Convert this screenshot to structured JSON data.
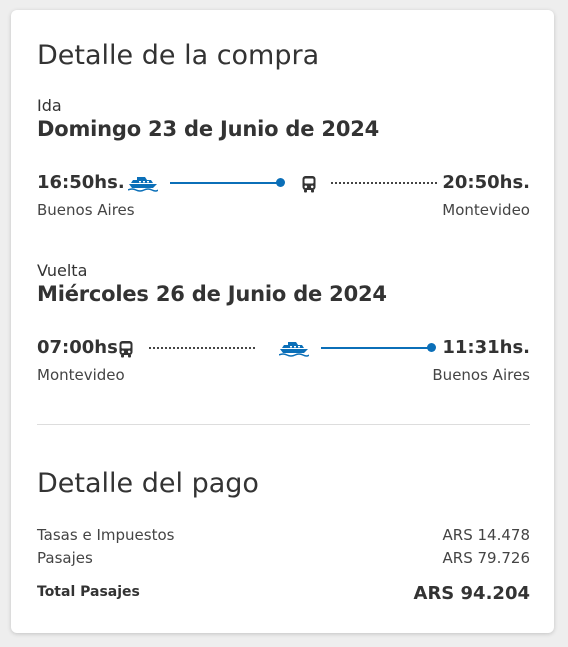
{
  "purchase": {
    "title": "Detalle de la compra"
  },
  "outbound": {
    "label": "Ida",
    "date": "Domingo 23 de Junio de 2024",
    "departure_time": "16:50hs.",
    "departure_city": "Buenos Aires",
    "arrival_time": "20:50hs.",
    "arrival_city": "Montevideo",
    "segments": [
      "ferry-icon",
      "bus-icon"
    ]
  },
  "return": {
    "label": "Vuelta",
    "date": "Miércoles 26 de Junio de 2024",
    "departure_time": "07:00hs.",
    "departure_city": "Montevideo",
    "arrival_time": "11:31hs.",
    "arrival_city": "Buenos Aires",
    "segments": [
      "bus-icon",
      "ferry-icon"
    ]
  },
  "payment": {
    "title": "Detalle del pago",
    "rows": [
      {
        "label": "Tasas e Impuestos",
        "value": "ARS 14.478"
      },
      {
        "label": "Pasajes",
        "value": "ARS 79.726"
      }
    ],
    "total_label": "Total Pasajes",
    "total_value": "ARS 94.204"
  },
  "colors": {
    "accent": "#0b6fb8",
    "text": "#333333",
    "background": "#eeeeee",
    "card": "#ffffff"
  }
}
